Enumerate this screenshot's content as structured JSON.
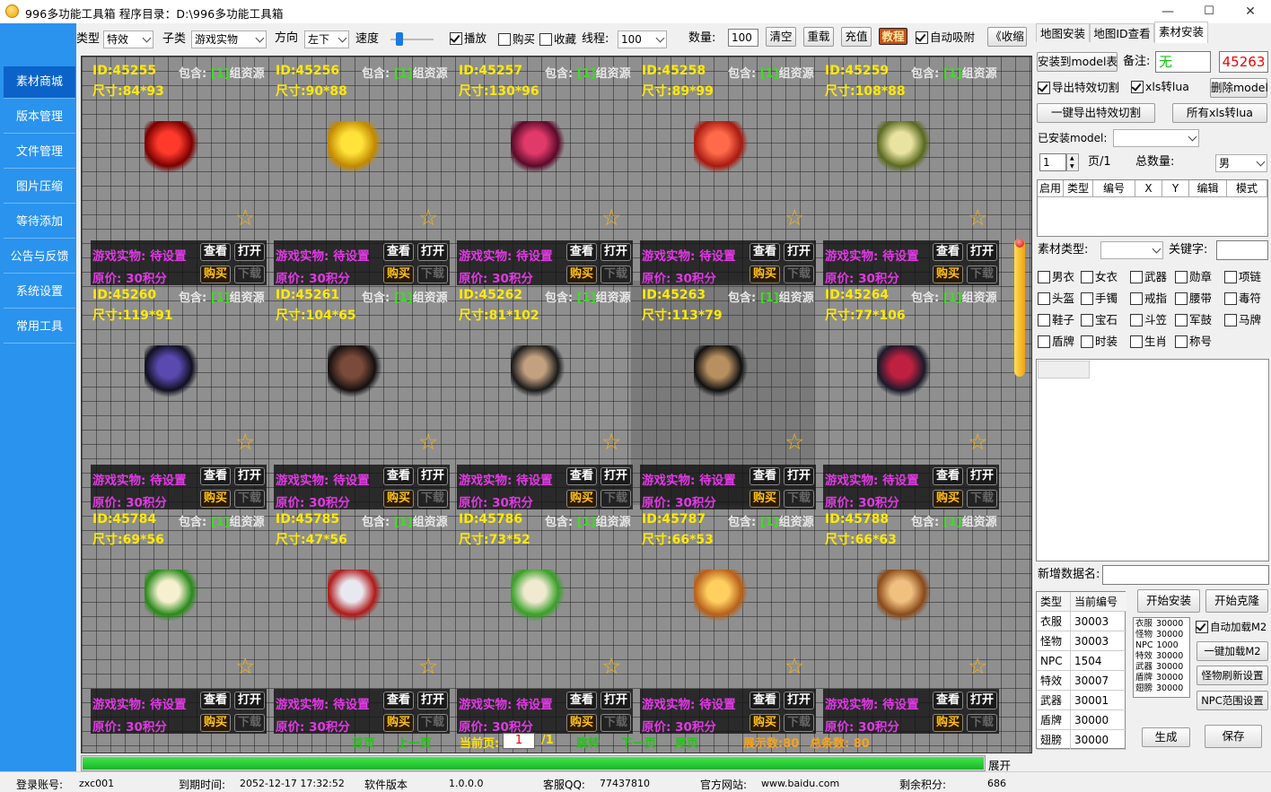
{
  "title": "996多功能工具箱    程序目录：D:\\996多功能工具箱",
  "window_controls": {
    "minimize": "—",
    "maximize": "☐",
    "close": "✕"
  },
  "sidebar": [
    {
      "label": "素材商城"
    },
    {
      "label": "版本管理"
    },
    {
      "label": "文件管理"
    },
    {
      "label": "图片压缩"
    },
    {
      "label": "等待添加"
    },
    {
      "label": "公告与反馈"
    },
    {
      "label": "系统设置"
    },
    {
      "label": "常用工具"
    }
  ],
  "toolbar": {
    "type_label": "类型",
    "type_value": "特效",
    "subtype_label": "子类",
    "subtype_value": "游戏实物",
    "direction_label": "方向",
    "direction_value": "左下",
    "speed_label": "速度",
    "speed_level": 0.12,
    "play": "播放",
    "buy": "购买",
    "favorite": "收藏",
    "threads_label": "线程:",
    "threads_value": "100",
    "count_label": "数量:",
    "count_value": "100",
    "clear": "清空",
    "reload": "重载",
    "recharge": "充值",
    "tutorial": "教程",
    "auto_attach": "自动吸附",
    "collapse": "《收缩"
  },
  "cards": [
    {
      "id": "ID:45255",
      "inc": "包含:",
      "n": "[1]",
      "group": "组资源",
      "size": "尺寸:84*93",
      "icon": "apple-icon",
      "c1": "#ff3a2a",
      "c2": "#7a0000"
    },
    {
      "id": "ID:45256",
      "inc": "包含:",
      "n": "[1]",
      "group": "组资源",
      "size": "尺寸:90*88",
      "icon": "banana-icon",
      "c1": "#ffe23a",
      "c2": "#c28a00"
    },
    {
      "id": "ID:45257",
      "inc": "包含:",
      "n": "[1]",
      "group": "组资源",
      "size": "尺寸:130*96",
      "icon": "grapes-icon",
      "c1": "#e03a6a",
      "c2": "#5a0a2a"
    },
    {
      "id": "ID:45258",
      "inc": "包含:",
      "n": "[1]",
      "group": "组资源",
      "size": "尺寸:89*99",
      "icon": "peach-icon",
      "c1": "#ff6a4a",
      "c2": "#a81a10"
    },
    {
      "id": "ID:45259",
      "inc": "包含:",
      "n": "[1]",
      "group": "组资源",
      "size": "尺寸:108*88",
      "icon": "melon-icon",
      "c1": "#e9e3a0",
      "c2": "#5a6a20"
    },
    {
      "id": "ID:45260",
      "inc": "包含:",
      "n": "[1]",
      "group": "组资源",
      "size": "尺寸:119*91",
      "icon": "mouse-icon",
      "c1": "#5a4ab0",
      "c2": "#101020"
    },
    {
      "id": "ID:45261",
      "inc": "包含:",
      "n": "[1]",
      "group": "组资源",
      "size": "尺寸:104*65",
      "icon": "keyboard-icon",
      "c1": "#7a4a3a",
      "c2": "#151010"
    },
    {
      "id": "ID:45262",
      "inc": "包含:",
      "n": "[1]",
      "group": "组资源",
      "size": "尺寸:81*102",
      "icon": "headphones-icon",
      "c1": "#c2a080",
      "c2": "#1a1a1a"
    },
    {
      "id": "ID:45263",
      "inc": "包含:",
      "n": "[1]",
      "group": "组资源",
      "size": "尺寸:113*79",
      "icon": "speakers-icon",
      "c1": "#b89060",
      "c2": "#101010"
    },
    {
      "id": "ID:45264",
      "inc": "包含:",
      "n": "[1]",
      "group": "组资源",
      "size": "尺寸:77*106",
      "icon": "gaming-chair-icon",
      "c1": "#c02040",
      "c2": "#1a1a2a"
    },
    {
      "id": "ID:45784",
      "inc": "包含:",
      "n": "[1]",
      "group": "组资源",
      "size": "尺寸:69*56",
      "icon": "dumpling-plate-icon",
      "c1": "#f6f0d0",
      "c2": "#2a8a1a"
    },
    {
      "id": "ID:45785",
      "inc": "包含:",
      "n": "[1]",
      "group": "组资源",
      "size": "尺寸:47*56",
      "icon": "can-icon",
      "c1": "#e8e8f0",
      "c2": "#b01a1a"
    },
    {
      "id": "ID:45786",
      "inc": "包含:",
      "n": "[1]",
      "group": "组资源",
      "size": "尺寸:73*52",
      "icon": "buns-plate-icon",
      "c1": "#f0ead0",
      "c2": "#3aa02a"
    },
    {
      "id": "ID:45787",
      "inc": "包含:",
      "n": "[1]",
      "group": "组资源",
      "size": "尺寸:66*53",
      "icon": "mooncake-icon",
      "c1": "#ffd060",
      "c2": "#b8601a"
    },
    {
      "id": "ID:45788",
      "inc": "包含:",
      "n": "[1]",
      "group": "组资源",
      "size": "尺寸:66*63",
      "icon": "steamer-icon",
      "c1": "#f0c080",
      "c2": "#8a4a1a"
    }
  ],
  "card_text": {
    "status": "游戏实物: 待设置",
    "price": "原价: 30积分",
    "view": "查看",
    "open": "打开",
    "buy": "购买",
    "download": "下载"
  },
  "pager": {
    "first": "首页",
    "prev": "上一页",
    "current_label": "当前页:",
    "current": "1",
    "total_pages": "/1",
    "jump": "跳转",
    "next": "下一页",
    "last": "尾页",
    "shown": "展示数:80",
    "total": "总条数: 80"
  },
  "progress": {
    "value": 1.0,
    "expand": "展开"
  },
  "right": {
    "tabs": [
      "地图安装",
      "地图ID查看",
      "素材安装"
    ],
    "install_btn": "安装到model表",
    "note_label": "备注:",
    "note_value": "无",
    "code_value": "45263",
    "export_cut": "导出特效切割",
    "xls_lua": "xls转lua",
    "delete_model": "删除model",
    "export_all": "一键导出特效切割",
    "all_xls": "所有xls转lua",
    "installed_label": "已安装model:",
    "page_value": "1",
    "page_of": "页/1",
    "total_label": "总数量:",
    "gender": "男",
    "table_headers": [
      "启用",
      "类型",
      "编号",
      "X",
      "Y",
      "编辑",
      "模式"
    ],
    "material_type": "素材类型:",
    "keyword": "关键字:",
    "checks": [
      "男衣",
      "女衣",
      "武器",
      "勋章",
      "项链",
      "头盔",
      "手镯",
      "戒指",
      "腰带",
      "毒符",
      "鞋子",
      "宝石",
      "斗笠",
      "军鼓",
      "马牌",
      "盾牌",
      "时装",
      "生肖",
      "称号"
    ],
    "new_name_label": "新增数据名:",
    "type_table": {
      "h1": "类型",
      "h2": "当前编号",
      "rows": [
        [
          "衣服",
          "30003"
        ],
        [
          "怪物",
          "30003"
        ],
        [
          "NPC",
          "1504"
        ],
        [
          "特效",
          "30007"
        ],
        [
          "武器",
          "30001"
        ],
        [
          "盾牌",
          "30000"
        ],
        [
          "翅膀",
          "30000"
        ]
      ]
    },
    "mini_list": [
      [
        "衣服",
        "30000"
      ],
      [
        "怪物",
        "30000"
      ],
      [
        "NPC",
        "1000"
      ],
      [
        "特效",
        "30000"
      ],
      [
        "武器",
        "30000"
      ],
      [
        "盾牌",
        "30000"
      ],
      [
        "翅膀",
        "30000"
      ]
    ],
    "start_install": "开始安装",
    "start_clone": "开始克隆",
    "auto_load": "自动加载M2",
    "one_load": "一键加载M2",
    "refresh_monster": "怪物刷新设置",
    "npc_range": "NPC范围设置",
    "generate": "生成",
    "save": "保存"
  },
  "status": {
    "login_label": "登录账号:",
    "login": "zxc001",
    "expire_label": "到期时间:",
    "expire": "2052-12-17 17:32:52",
    "version_label": "软件版本",
    "version": "1.0.0.0",
    "qq_label": "客服QQ:",
    "qq": "77437810",
    "site_label": "官方网站:",
    "site": "www.baidu.com",
    "points_label": "剩余积分:",
    "points": "686"
  },
  "colors": {
    "sidebar": "#2a93ee",
    "sidebar_active": "#0b63c9",
    "card_text": "#e239e6",
    "id_text": "#ffea00",
    "green": "#3edc23"
  }
}
